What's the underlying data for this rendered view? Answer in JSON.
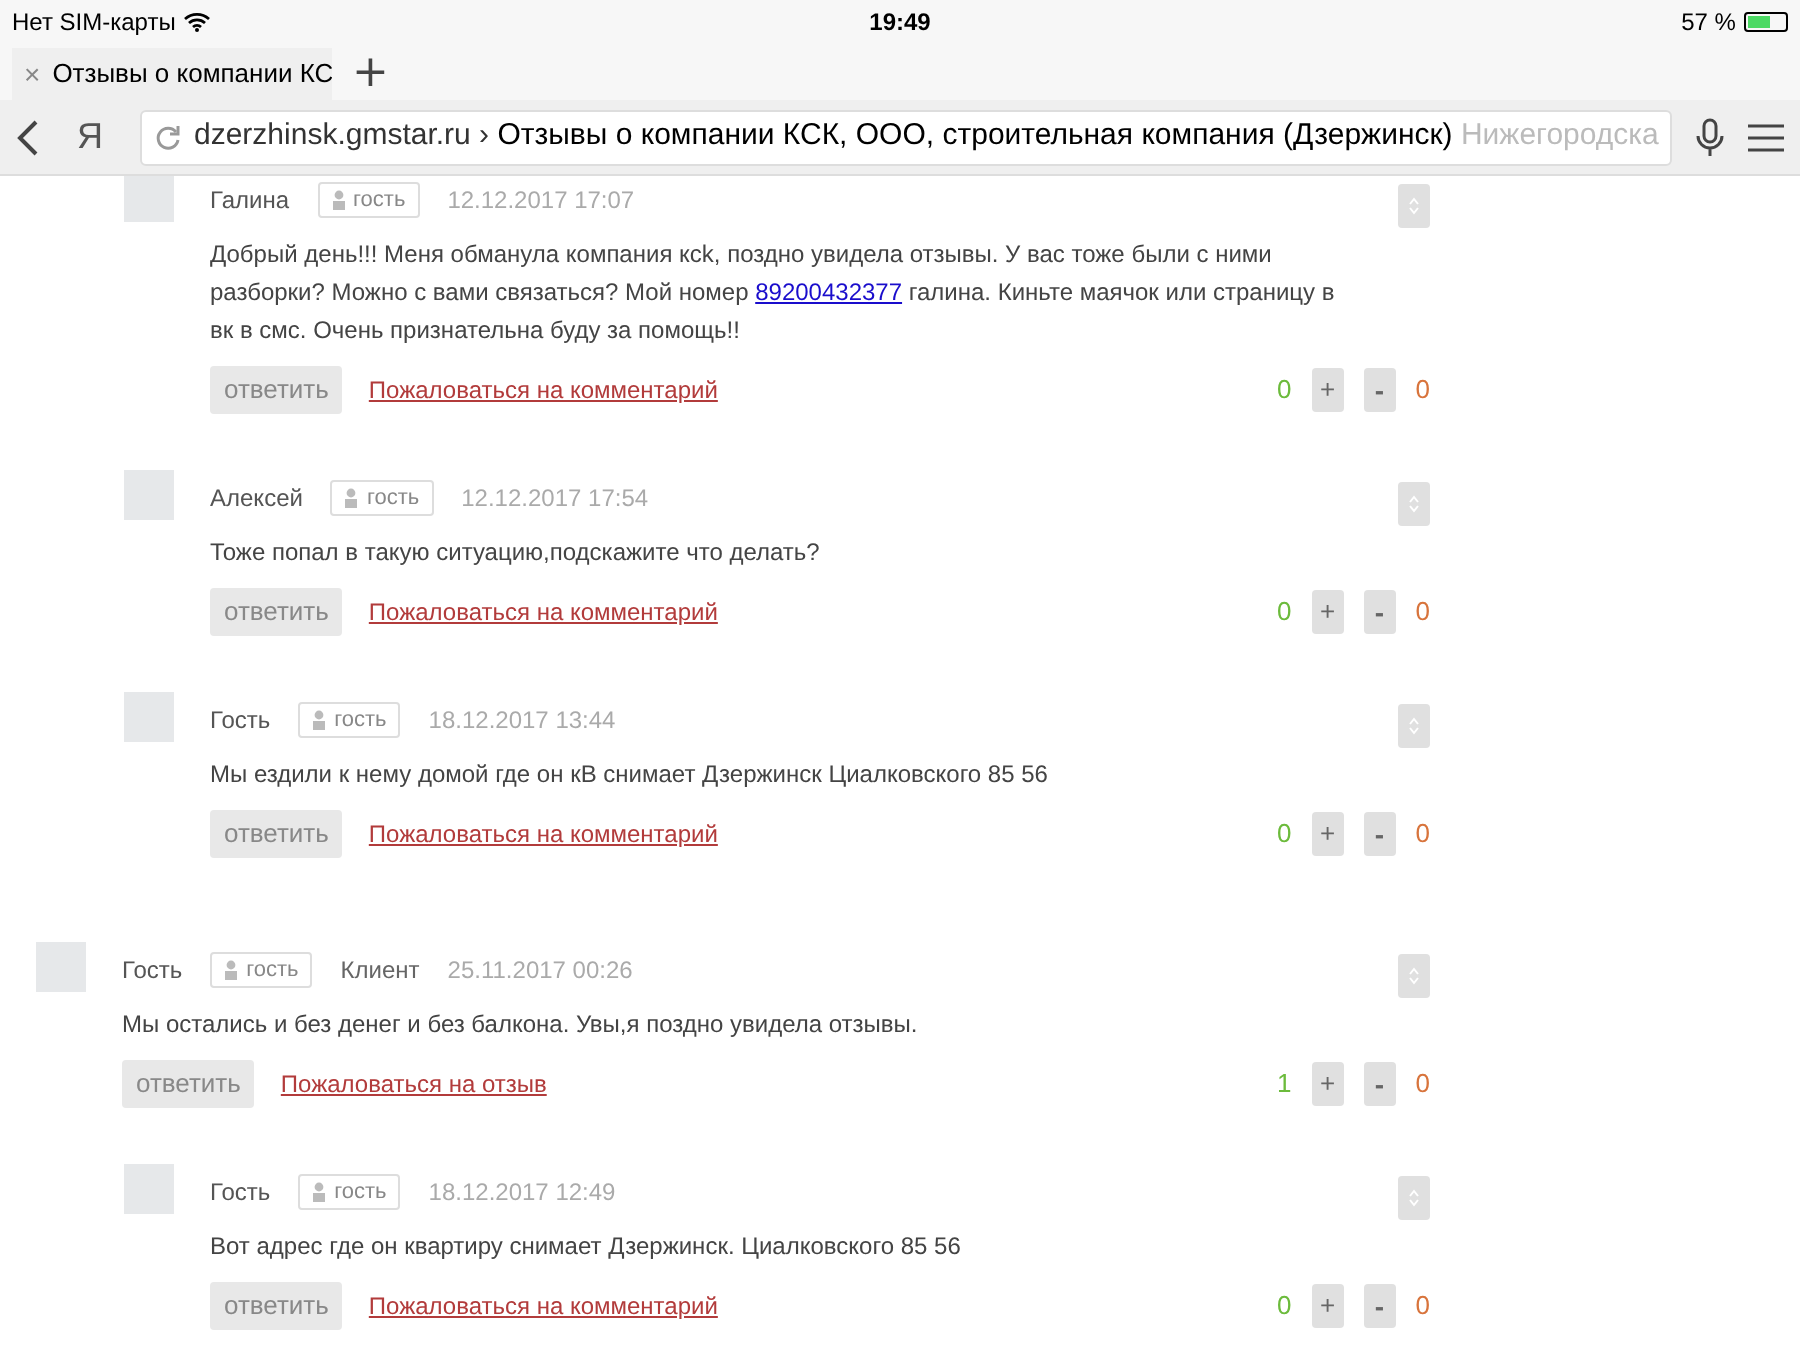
{
  "status_bar": {
    "carrier": "Нет SIM-карты",
    "time": "19:49",
    "battery": "57 %"
  },
  "tabs": [
    {
      "label": "Отзывы о компании КС",
      "selected": true,
      "close": "×"
    }
  ],
  "new_tab": "+",
  "address_bar": {
    "logo": "Я",
    "domain": "dzerzhinsk.gmstar.ru",
    "separator": "›",
    "title": "Отзывы о компании КСК, ООО, строительная компания (Дзержинск)",
    "title_faded": "Нижегородска"
  },
  "threads": [
    {
      "replies": [
        {
          "author": "Галина",
          "badge": "гость",
          "date": "12.12.2017 17:07",
          "text": [
            {
              "kind": "plain",
              "text": "Добрый день!!! Меня обманула компания ксk, поздно увидела отзывы. У вас тоже были с ними разборки? Можно с вами связаться? Мой номер "
            },
            {
              "kind": "link",
              "text": "89200432377"
            },
            {
              "kind": "plain",
              "text": " галина. Киньте маячок или страницу в вк в смс. Очень признательна буду за помощь!!"
            }
          ],
          "reply": "ответить",
          "complain": "Пожаловаться на комментарий",
          "likes": "0",
          "plus": "+",
          "minus": "-",
          "dislikes": "0"
        },
        {
          "author": "Алексей",
          "badge": "гость",
          "date": "12.12.2017 17:54",
          "text": [
            {
              "kind": "plain",
              "text": "Тоже попал в такую ситуацию,подскажите что делать?"
            }
          ],
          "reply": "ответить",
          "complain": "Пожаловаться на комментарий",
          "likes": "0",
          "plus": "+",
          "minus": "-",
          "dislikes": "0"
        },
        {
          "author": "Гость",
          "badge": "гость",
          "date": "18.12.2017 13:44",
          "text": [
            {
              "kind": "plain",
              "text": "Мы ездили к нему домой где он кВ снимает Дзержинск Циалковского 85 56"
            }
          ],
          "reply": "ответить",
          "complain": "Пожаловаться на комментарий",
          "likes": "0",
          "plus": "+",
          "minus": "-",
          "dislikes": "0"
        }
      ]
    },
    {
      "review": {
        "author": "Гость",
        "badge": "гость",
        "role": "Клиент",
        "date": "25.11.2017 00:26",
        "text": [
          {
            "kind": "plain",
            "text": "Мы остались и без денег и без балкона. Увы,я поздно увидела отзывы."
          }
        ],
        "reply": "ответить",
        "complain": "Пожаловаться на отзыв",
        "likes": "1",
        "plus": "+",
        "minus": "-",
        "dislikes": "0"
      },
      "replies": [
        {
          "author": "Гость",
          "badge": "гость",
          "date": "18.12.2017 12:49",
          "text": [
            {
              "kind": "plain",
              "text": "Вот адрес где он квартиру снимает Дзержинск. Циалковского 85 56"
            }
          ],
          "reply": "ответить",
          "complain": "Пожаловаться на комментарий",
          "likes": "0",
          "plus": "+",
          "minus": "-",
          "dislikes": "0"
        }
      ]
    }
  ]
}
